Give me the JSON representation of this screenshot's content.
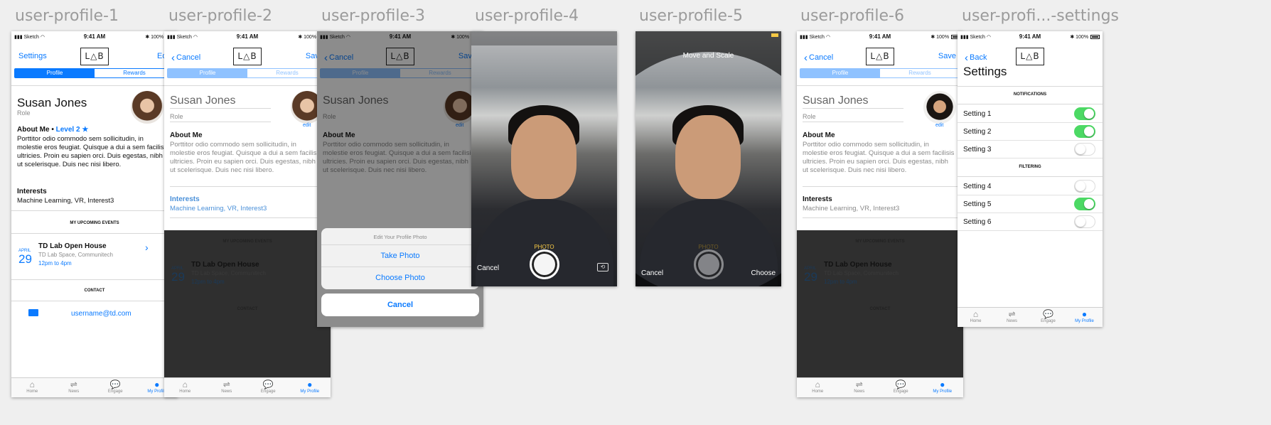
{
  "artboards": [
    "user-profile-1",
    "user-profile-2",
    "user-profile-3",
    "user-profile-4",
    "user-profile-5",
    "user-profile-6",
    "user-profi...-settings"
  ],
  "status": {
    "carrier": "Sketch",
    "time": "9:41 AM",
    "battery": "100%"
  },
  "logo": "L△B",
  "seg": {
    "profile": "Profile",
    "rewards": "Rewards"
  },
  "nav": {
    "settings": "Settings",
    "edit": "Edit",
    "cancel": "Cancel",
    "save": "Save",
    "back": "Back",
    "choose": "Choose"
  },
  "profile": {
    "name": "Susan Jones",
    "role": "Role",
    "about_label": "About Me",
    "dot": "•",
    "level": "Level 2",
    "bio": "Porttitor odio commodo sem sollicitudin, in molestie eros feugiat. Quisque a dui a sem facilisis ultricies. Proin eu sapien orci. Duis egestas, nibh ut scelerisque. Duis nec nisi libero.",
    "interests_label": "Interests",
    "interests": "Machine Learning, VR, Interest3",
    "edit_link": "edit"
  },
  "events": {
    "header": "MY UPCOMING EVENTS",
    "title": "TD Lab Open House",
    "location": "TD Lab Space, Communitech",
    "time": "12pm to 4pm",
    "month": "APRIL",
    "day": "29"
  },
  "contact": {
    "header": "CONTACT",
    "email": "username@td.com"
  },
  "tabs": [
    "Home",
    "News",
    "Engage",
    "My Profile"
  ],
  "sheet": {
    "title": "Edit Your Profile Photo",
    "take": "Take Photo",
    "choose": "Choose Photo",
    "cancel": "Cancel"
  },
  "camera": {
    "mode": "PHOTO",
    "cancel": "Cancel",
    "move_scale": "Move and Scale"
  },
  "settings": {
    "title": "Settings",
    "notifications": "NOTIFICATIONS",
    "filtering": "FILTERING",
    "items": [
      "Setting 1",
      "Setting 2",
      "Setting 3",
      "Setting 4",
      "Setting 5",
      "Setting 6"
    ],
    "states": [
      true,
      true,
      false,
      false,
      true,
      false
    ]
  },
  "colors": {
    "accent": "#0a7aff",
    "toggle_on": "#4cd964",
    "camera_yellow": "#f6c945"
  }
}
